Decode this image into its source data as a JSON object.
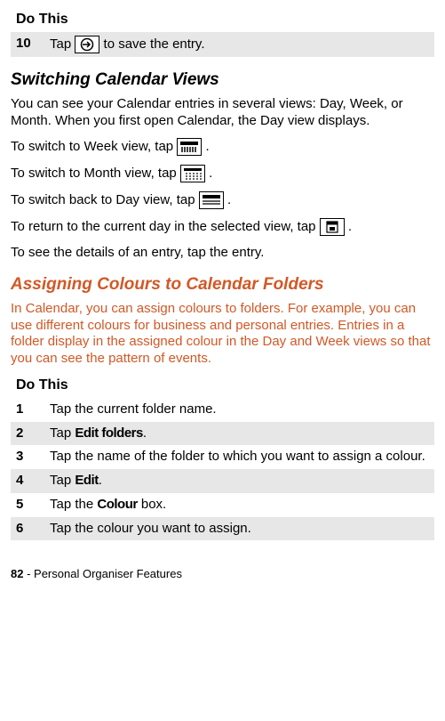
{
  "top_table": {
    "header": "Do This",
    "row": {
      "num": "10",
      "before": "Tap ",
      "after": " to save the entry."
    }
  },
  "section1": {
    "title": "Switching Calendar Views",
    "p1": "You can see your Calendar entries in several views: Day, Week, or Month. When you first open Calendar, the Day view displays.",
    "p2_before": "To switch to Week view, tap ",
    "p3_before": "To switch to Month view, tap ",
    "p4_before": "To switch back to Day view, tap ",
    "p5_before": "To return to the current day in the selected view, tap ",
    "p6": "To see the details of an entry, tap the entry.",
    "period": "."
  },
  "section2": {
    "title": "Assigning Colours to Calendar Folders",
    "p1": "In Calendar, you can assign colours to folders. For example, you can use different colours for business and personal entries. Entries in a folder display in the assigned colour in the Day and Week views so that you can see the pattern of events."
  },
  "steps_table": {
    "header": "Do This",
    "rows": [
      {
        "num": "1",
        "text": "Tap the current folder name."
      },
      {
        "num": "2",
        "before": "Tap ",
        "ui": "Edit folders",
        "after": "."
      },
      {
        "num": "3",
        "text": "Tap the name of the folder to which you want to assign a colour."
      },
      {
        "num": "4",
        "before": "Tap ",
        "ui": "Edit",
        "after": "."
      },
      {
        "num": "5",
        "before": "Tap the ",
        "ui": "Colour",
        "after": " box."
      },
      {
        "num": "6",
        "text": "Tap the colour you want to assign."
      }
    ]
  },
  "footer": {
    "page": "82",
    "sep": " - ",
    "section": "Personal Organiser Features"
  }
}
